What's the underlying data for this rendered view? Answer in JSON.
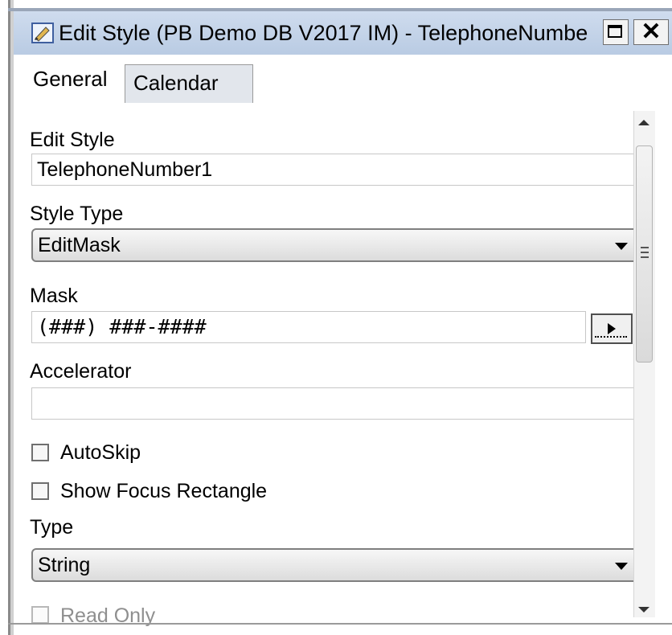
{
  "window": {
    "title": "Edit Style (PB Demo DB V2017 IM) - TelephoneNumbe",
    "maximize_icon": "maximize-icon",
    "close_label": "✕"
  },
  "tabs": [
    {
      "label": "General"
    },
    {
      "label": "Calendar"
    }
  ],
  "form": {
    "edit_style_label": "Edit Style",
    "edit_style_value": "TelephoneNumber1",
    "style_type_label": "Style Type",
    "style_type_value": "EditMask",
    "mask_label": "Mask",
    "mask_value": "(###) ###-####",
    "accelerator_label": "Accelerator",
    "accelerator_value": "",
    "autoskip_label": "AutoSkip",
    "show_focus_label": "Show Focus Rectangle",
    "type_label": "Type",
    "type_value": "String",
    "readonly_label": "Read Only"
  }
}
